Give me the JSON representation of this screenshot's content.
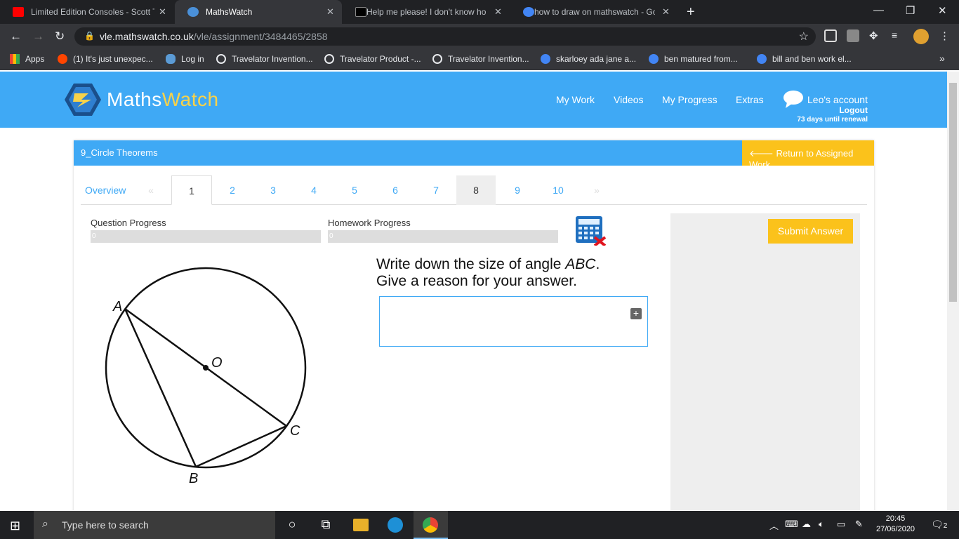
{
  "browser": {
    "tabs": [
      {
        "title": "Limited Edition Consoles - Scott T",
        "fav": "#ff0000"
      },
      {
        "title": "MathsWatch",
        "fav": "#4a90d9"
      },
      {
        "title": "Help me please! I don't know ho",
        "fav": "#000000"
      },
      {
        "title": "how to draw on mathswatch - Go",
        "fav": "#4285f4"
      }
    ],
    "url_host": "vle.mathswatch.co.uk",
    "url_path": "/vle/assignment/3484465/2858",
    "bookmarks": [
      "Apps",
      "(1) It's just unexpec...",
      "Log in",
      "Travelator Invention...",
      "Travelator Product -...",
      "Travelator Invention...",
      "skarloey ada jane a...",
      "ben matured from...",
      "bill and ben work el..."
    ]
  },
  "site": {
    "logo_a": "Maths",
    "logo_b": "Watch",
    "nav": [
      "My Work",
      "Videos",
      "My Progress",
      "Extras"
    ],
    "account": "Leo's account",
    "logout": "Logout",
    "renewal": "73 days until renewal"
  },
  "assignment": {
    "title": "9_Circle Theorems",
    "return_label": "Return to Assigned Work",
    "tabs": [
      "Overview",
      "«",
      "1",
      "2",
      "3",
      "4",
      "5",
      "6",
      "7",
      "8",
      "9",
      "10",
      "»"
    ],
    "question_progress_label": "Question Progress",
    "question_progress": "0",
    "homework_progress_label": "Homework Progress",
    "homework_progress": "0",
    "submit_label": "Submit Answer",
    "question_line1_pre": "Write down the size of angle ",
    "question_angle": "ABC",
    "question_line1_post": ".",
    "question_line2": "Give a reason for your answer.",
    "diagram": {
      "labels": [
        "A",
        "O",
        "C",
        "B"
      ]
    }
  },
  "taskbar": {
    "search_placeholder": "Type here to search",
    "time": "20:45",
    "date": "27/06/2020",
    "notifications": "2"
  }
}
